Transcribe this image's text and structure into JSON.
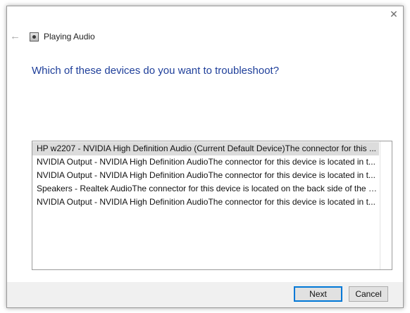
{
  "window": {
    "close_glyph": "✕"
  },
  "header": {
    "back_glyph": "←",
    "title": "Playing Audio"
  },
  "main": {
    "question": "Which of these devices do you want to troubleshoot?",
    "devices": [
      "HP w2207 - NVIDIA High Definition Audio (Current Default Device)The connector for this ...",
      "NVIDIA Output - NVIDIA High Definition AudioThe connector for this device is located in t...",
      "NVIDIA Output - NVIDIA High Definition AudioThe connector for this device is located in t...",
      "Speakers - Realtek AudioThe connector for this device is located on the back side of the c...",
      "NVIDIA Output - NVIDIA High Definition AudioThe connector for this device is located in t..."
    ],
    "selected_index": 0
  },
  "footer": {
    "next_label": "Next",
    "cancel_label": "Cancel"
  },
  "colors": {
    "accent": "#0078d7",
    "question_text": "#1f3f9a",
    "selection": "#dcdcdc",
    "footer_bg": "#f0f0f0"
  }
}
